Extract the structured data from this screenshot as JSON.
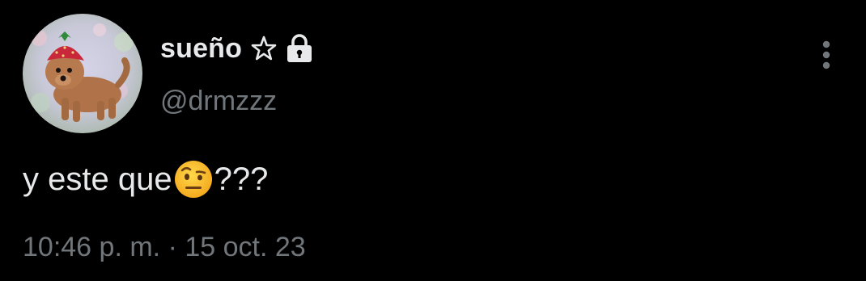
{
  "tweet": {
    "author": {
      "display_name": "sueño",
      "handle": "@drmzzz",
      "badge_icons": [
        "star-outline-icon",
        "lock-icon"
      ],
      "avatar_icon": "dog-avatar"
    },
    "text_before_emoji": "y este que",
    "emoji_icon": "face-with-raised-eyebrow-emoji",
    "text_after_emoji": "???",
    "time": "10:46 p. m.",
    "separator": "·",
    "date": "15 oct. 23",
    "more_icon": "more-vertical-icon"
  },
  "colors": {
    "background": "#000000",
    "primary_text": "#e7e9ea",
    "secondary_text": "#71767b"
  }
}
